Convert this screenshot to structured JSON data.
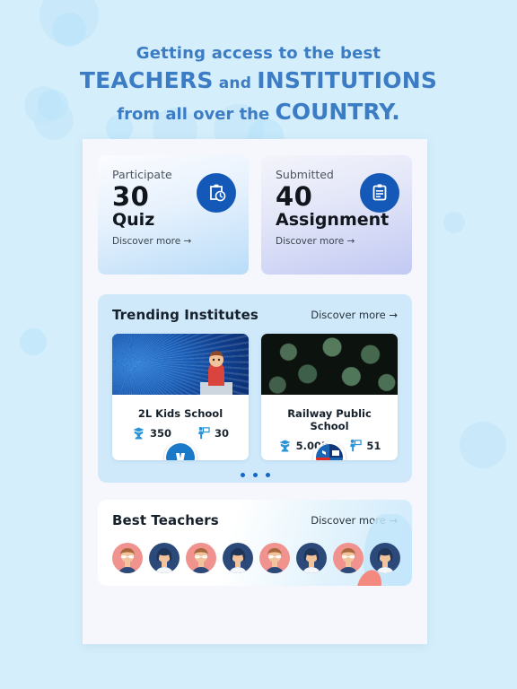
{
  "page": {
    "background_color": "#d4eefb",
    "panel_background": "#f6f7fc"
  },
  "headline": {
    "line1": "Getting access to the best",
    "line2_strong_a": "TEACHERS",
    "line2_small": " and ",
    "line2_strong_b": "INSTITUTIONS",
    "line3_small": "from all over the ",
    "line3_strong": "COUNTRY.",
    "color": "#3c7cc4"
  },
  "stat_cards": [
    {
      "label": "Participate",
      "number": "30",
      "title": "Quiz",
      "discover": "Discover more →",
      "icon": "clipboard-clock-icon",
      "icon_bg": "#1559b8"
    },
    {
      "label": "Submitted",
      "number": "40",
      "title": "Assignment",
      "discover": "Discover more →",
      "icon": "clipboard-lines-icon",
      "icon_bg": "#1559b8"
    }
  ],
  "trending": {
    "title": "Trending Institutes",
    "discover": "Discover more  →",
    "section_bg": "#cfe9fb",
    "institutes": [
      {
        "name": "2L Kids School",
        "students": "350",
        "teachers": "30",
        "students_icon": "graduate-student-icon",
        "teachers_icon": "teacher-board-icon",
        "photo": "blue-feather-photo",
        "logo": "kids-school-logo"
      },
      {
        "name": "Railway Public School",
        "students": "5.00K",
        "teachers": "51",
        "students_icon": "graduate-student-icon",
        "teachers_icon": "teacher-board-icon",
        "photo": "green-ginkgo-leaves-photo",
        "logo": "railway-school-logo"
      }
    ],
    "carousel_dots": 3,
    "active_dot_color": "#1666c4"
  },
  "teachers": {
    "title": "Best Teachers",
    "discover": "Discover more  →",
    "avatars": [
      {
        "style": "pink",
        "type": "male-glasses-avatar"
      },
      {
        "style": "navy",
        "type": "female-avatar"
      },
      {
        "style": "pink",
        "type": "male-glasses-avatar"
      },
      {
        "style": "navy",
        "type": "female-avatar"
      },
      {
        "style": "pink",
        "type": "male-glasses-avatar"
      },
      {
        "style": "navy",
        "type": "female-avatar"
      },
      {
        "style": "pink",
        "type": "male-glasses-avatar"
      },
      {
        "style": "navy",
        "type": "female-avatar"
      }
    ]
  }
}
